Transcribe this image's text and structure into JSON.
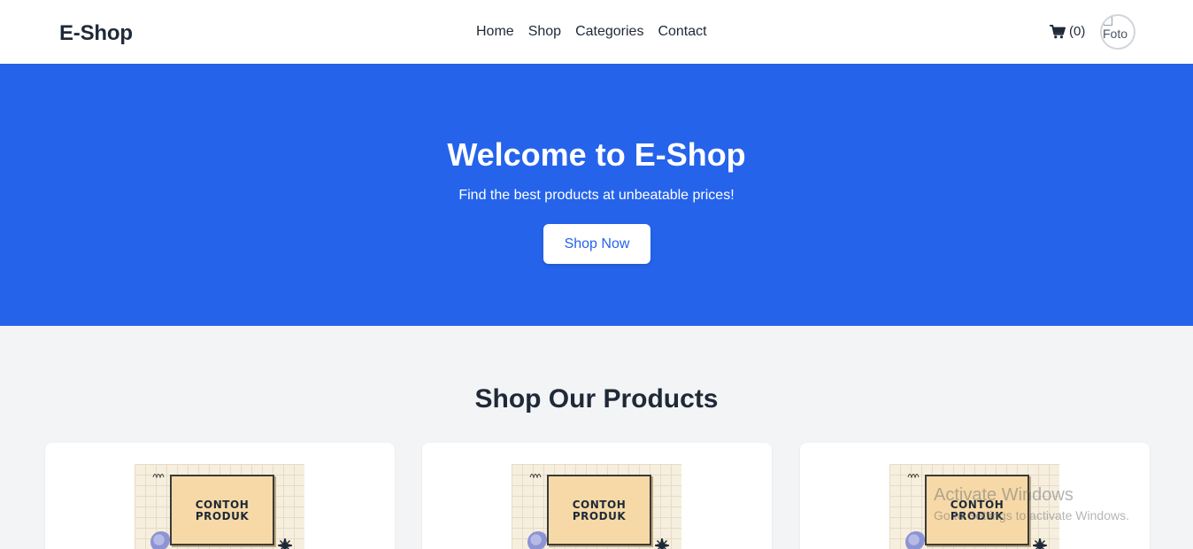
{
  "header": {
    "brand": "E-Shop",
    "nav": [
      "Home",
      "Shop",
      "Categories",
      "Contact"
    ],
    "cart_count": "(0)",
    "avatar_alt": "Foto"
  },
  "hero": {
    "title": "Welcome to E-Shop",
    "subtitle": "Find the best products at unbeatable prices!",
    "cta": "Shop Now"
  },
  "products_section": {
    "title": "Shop Our Products",
    "cards": [
      {
        "image_label_line1": "CONTOH",
        "image_label_line2": "PRODUK"
      },
      {
        "image_label_line1": "CONTOH",
        "image_label_line2": "PRODUK"
      },
      {
        "image_label_line1": "CONTOH",
        "image_label_line2": "PRODUK"
      }
    ]
  },
  "watermark": {
    "title": "Activate Windows",
    "subtitle": "Go to Settings to activate Windows."
  },
  "colors": {
    "primary": "#2563eb",
    "background": "#f3f4f6",
    "text": "#1f2937"
  },
  "icons": {
    "cart": "shopping-cart-icon",
    "avatar": "user-avatar-image"
  }
}
